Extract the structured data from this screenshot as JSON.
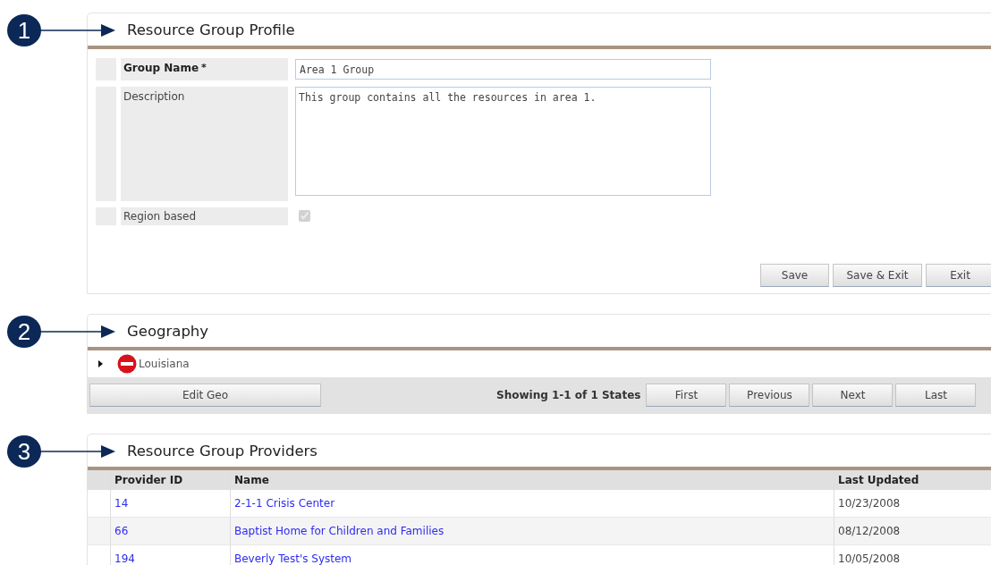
{
  "sections": [
    {
      "kind": "form",
      "callout": "1",
      "title": "Resource Group Profile",
      "required_mark": "*",
      "fields": [
        {
          "kind": "text",
          "label": "Group Name",
          "required": true,
          "value": "Area 1 Group"
        },
        {
          "kind": "textarea",
          "label": "Description",
          "required": false,
          "value": "This group contains all the resources in area 1."
        },
        {
          "kind": "checkbox",
          "label": "Region based",
          "required": false,
          "checked": true,
          "disabled": true
        }
      ],
      "buttons": [
        "Save",
        "Save & Exit",
        "Exit"
      ]
    },
    {
      "kind": "tree",
      "callout": "2",
      "title": "Geography",
      "items": [
        {
          "label": "Louisiana",
          "expanded": false
        }
      ],
      "edit_button": "Edit Geo",
      "paging_text": "Showing 1-1 of 1 States",
      "paging_buttons": [
        "First",
        "Previous",
        "Next",
        "Last"
      ]
    },
    {
      "kind": "table",
      "callout": "3",
      "title": "Resource Group Providers",
      "columns": [
        "Provider ID",
        "Name",
        "Last Updated"
      ],
      "rows": [
        [
          "14",
          "2-1-1 Crisis Center",
          "10/23/2008"
        ],
        [
          "66",
          "Baptist Home for Children and Families",
          "08/12/2008"
        ],
        [
          "194",
          "Beverly Test's System",
          "10/05/2008"
        ]
      ]
    }
  ]
}
